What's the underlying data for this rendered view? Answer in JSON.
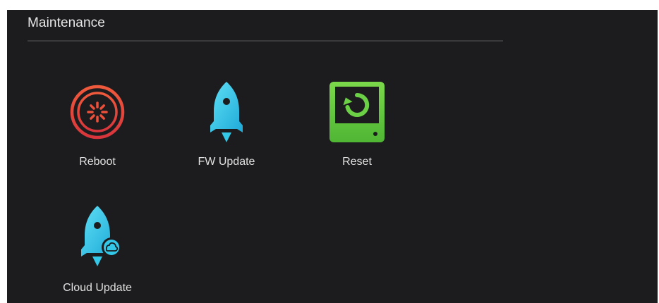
{
  "section": {
    "title": "Maintenance"
  },
  "tiles": [
    {
      "label": "Reboot",
      "icon": "reboot-icon",
      "color": "#e5473b"
    },
    {
      "label": "FW Update",
      "icon": "rocket-icon",
      "color": "#33c7e8"
    },
    {
      "label": "Reset",
      "icon": "reset-icon",
      "color": "#63c93f"
    },
    {
      "label": "Cloud Update",
      "icon": "cloud-rocket-icon",
      "color": "#33c7e8"
    }
  ]
}
